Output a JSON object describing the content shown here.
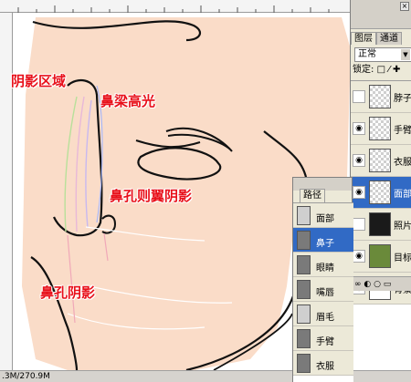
{
  "canvas": {
    "annotations": {
      "shadow_area": "阴影区域",
      "nose_bridge_highlight": "鼻梁高光",
      "nostril_wing_shadow": "鼻孔则翼阴影",
      "nostril_shadow": "鼻孔阴影"
    },
    "skin_color": "#fadcc8",
    "line_color": "#111111"
  },
  "status_bar": {
    "doc_size": ".3M/270.9M"
  },
  "layers_panel": {
    "tabs": [
      "图层",
      "通道"
    ],
    "blend_mode": "正常",
    "lock_label": "锁定:",
    "lock_icons": "□ ⁄ ✚",
    "layers": [
      {
        "name": "脖子",
        "visible": false,
        "thumb": "transparent",
        "selected": false
      },
      {
        "name": "手臂",
        "visible": true,
        "thumb": "transparent",
        "selected": false
      },
      {
        "name": "衣服",
        "visible": true,
        "thumb": "transparent",
        "selected": false
      },
      {
        "name": "面部",
        "visible": true,
        "thumb": "transparent",
        "selected": true
      },
      {
        "name": "照片",
        "visible": false,
        "thumb": "photo",
        "selected": false
      },
      {
        "name": "目标图",
        "visible": true,
        "thumb": "target",
        "selected": false
      },
      {
        "name": "背景",
        "visible": true,
        "thumb": "white",
        "selected": false
      }
    ],
    "bottom_icons": "∞ ◐ ○ ▭"
  },
  "paths_panel": {
    "tab": "路径",
    "paths": [
      {
        "name": "面部",
        "selected": false,
        "thumb": "light"
      },
      {
        "name": "鼻子",
        "selected": true,
        "thumb": "dark"
      },
      {
        "name": "眼睛",
        "selected": false,
        "thumb": "dark"
      },
      {
        "name": "嘴唇",
        "selected": false,
        "thumb": "dark"
      },
      {
        "name": "眉毛",
        "selected": false,
        "thumb": "light"
      },
      {
        "name": "手臂",
        "selected": false,
        "thumb": "dark"
      },
      {
        "name": "衣服",
        "selected": false,
        "thumb": "dark"
      }
    ]
  }
}
